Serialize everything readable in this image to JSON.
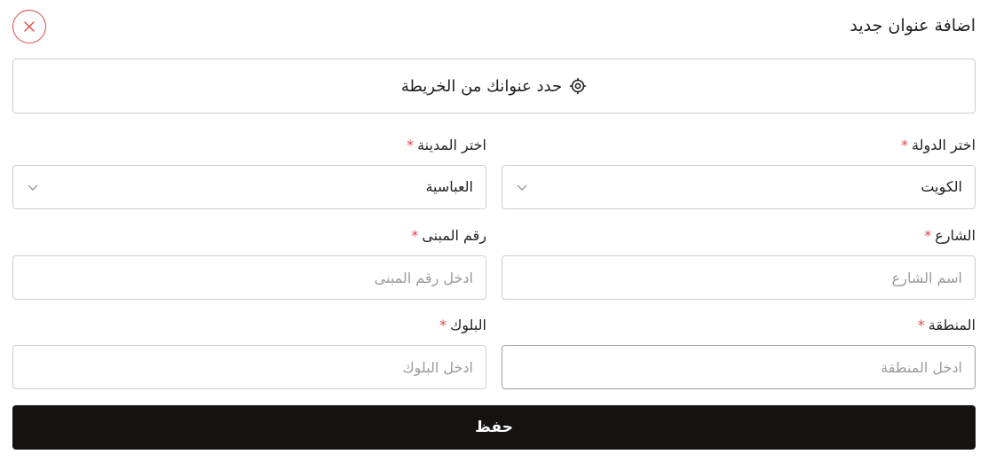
{
  "header": {
    "title": "اضافة عنوان جديد",
    "close_icon": "close-icon",
    "close_color": "#e0464b"
  },
  "map_button": {
    "label": "حدد عنوانك من الخريطة",
    "icon": "location-target-icon"
  },
  "form": {
    "required_mark": "*",
    "country": {
      "label": "اختر الدولة",
      "value": "الكويت",
      "icon": "chevron-down-icon"
    },
    "city": {
      "label": "اختر المدينة",
      "value": "العباسية",
      "icon": "chevron-down-icon"
    },
    "street": {
      "label": "الشارع",
      "placeholder": "اسم الشارع",
      "value": ""
    },
    "building": {
      "label": "رقم المبنى",
      "placeholder": "ادخل رقم المبنى",
      "value": ""
    },
    "area": {
      "label": "المنطقة",
      "placeholder": "ادخل المنطقة",
      "value": ""
    },
    "block": {
      "label": "البلوك",
      "placeholder": "ادخل البلوك",
      "value": ""
    }
  },
  "save_button": {
    "label": "حفظ",
    "background": "#141311"
  }
}
